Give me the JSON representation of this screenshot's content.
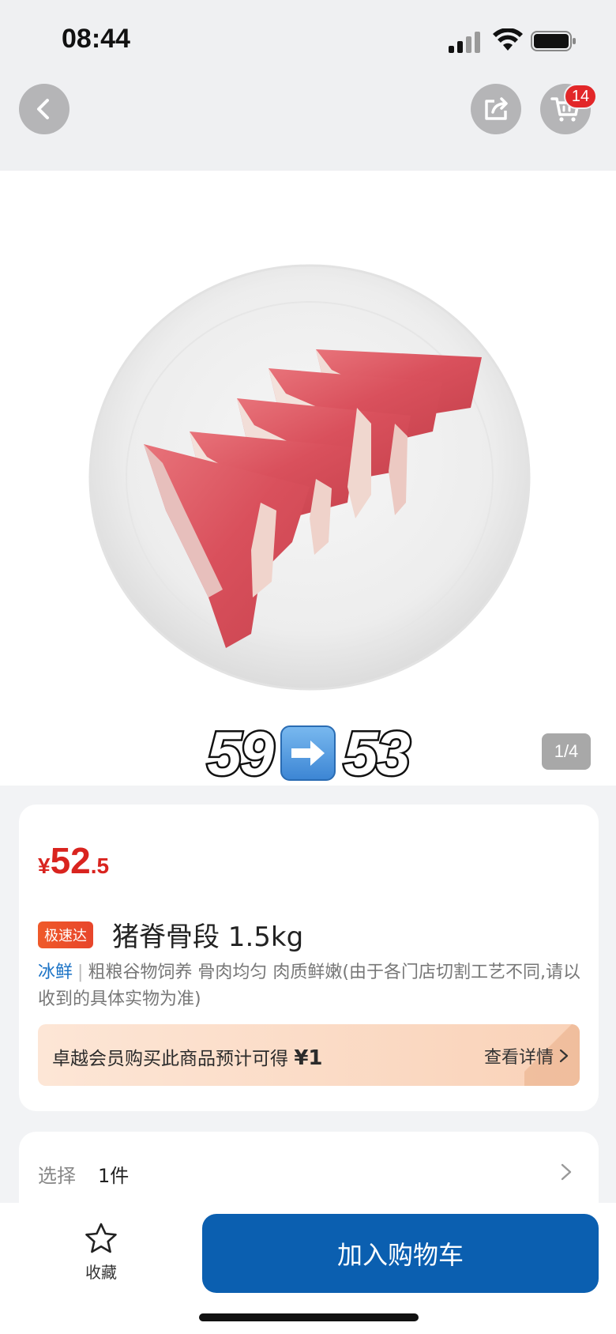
{
  "status_bar": {
    "time": "08:44"
  },
  "nav": {
    "cart_badge": "14"
  },
  "gallery": {
    "overlay_old_price": "59",
    "overlay_new_price": "53",
    "page_indicator": "1/4"
  },
  "product": {
    "price_symbol": "¥",
    "price_integer": "52",
    "price_decimal": ".5",
    "speed_tag": "极速达",
    "title": "猪脊骨段 1.5kg",
    "fresh_tag": "冰鲜",
    "description": "粗粮谷物饲养 骨肉均匀 肉质鲜嫩(由于各门店切割工艺不同,请以收到的具体实物为准)",
    "member_text": "卓越会员购买此商品预计可得",
    "member_amount": "¥1",
    "member_link": "查看详情"
  },
  "selection": {
    "label": "选择",
    "value": "1件"
  },
  "bottom_bar": {
    "favorite_label": "收藏",
    "add_to_cart_label": "加入购物车"
  },
  "colors": {
    "price_red": "#d9241f",
    "cta_blue": "#0b5fb0",
    "badge_red": "#e22729"
  }
}
